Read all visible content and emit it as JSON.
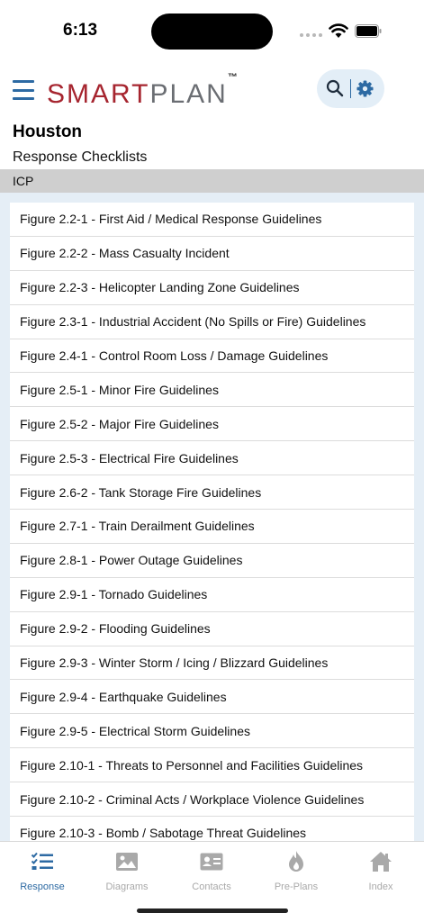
{
  "status": {
    "time": "6:13"
  },
  "header": {
    "logo_part1": "SMART",
    "logo_part2": "PLAN",
    "logo_tm": "™"
  },
  "page": {
    "site": "Houston",
    "section": "Response Checklists",
    "group": "ICP"
  },
  "checklists": [
    "Figure 2.2-1 - First Aid / Medical Response Guidelines",
    "Figure 2.2-2 - Mass Casualty Incident",
    "Figure 2.2-3 - Helicopter Landing Zone Guidelines",
    "Figure 2.3-1 - Industrial Accident (No Spills or Fire) Guidelines",
    "Figure 2.4-1 - Control Room Loss / Damage Guidelines",
    "Figure 2.5-1 - Minor Fire Guidelines",
    "Figure 2.5-2 - Major Fire Guidelines",
    "Figure 2.5-3 - Electrical Fire Guidelines",
    "Figure 2.6-2 - Tank Storage Fire Guidelines",
    "Figure 2.7-1 - Train Derailment Guidelines",
    "Figure 2.8-1 - Power Outage Guidelines",
    "Figure 2.9-1 - Tornado Guidelines",
    "Figure 2.9-2 - Flooding Guidelines",
    "Figure 2.9-3 - Winter Storm / Icing / Blizzard Guidelines",
    "Figure 2.9-4 - Earthquake Guidelines",
    "Figure 2.9-5 - Electrical Storm Guidelines",
    "Figure 2.10-1 - Threats to Personnel and Facilities Guidelines",
    "Figure 2.10-2 - Criminal Acts / Workplace Violence Guidelines",
    "Figure 2.10-3 - Bomb / Sabotage Threat Guidelines"
  ],
  "tabs": [
    {
      "label": "Response",
      "icon": "checklist-icon",
      "active": true
    },
    {
      "label": "Diagrams",
      "icon": "image-icon",
      "active": false
    },
    {
      "label": "Contacts",
      "icon": "contact-card-icon",
      "active": false
    },
    {
      "label": "Pre-Plans",
      "icon": "flame-icon",
      "active": false
    },
    {
      "label": "Index",
      "icon": "home-icon",
      "active": false
    }
  ],
  "colors": {
    "accent": "#2d6aa3",
    "brand_red": "#a6252f",
    "brand_gray": "#6b6e73",
    "list_background": "#e5eef6",
    "group_bar": "#cfcfcf"
  }
}
